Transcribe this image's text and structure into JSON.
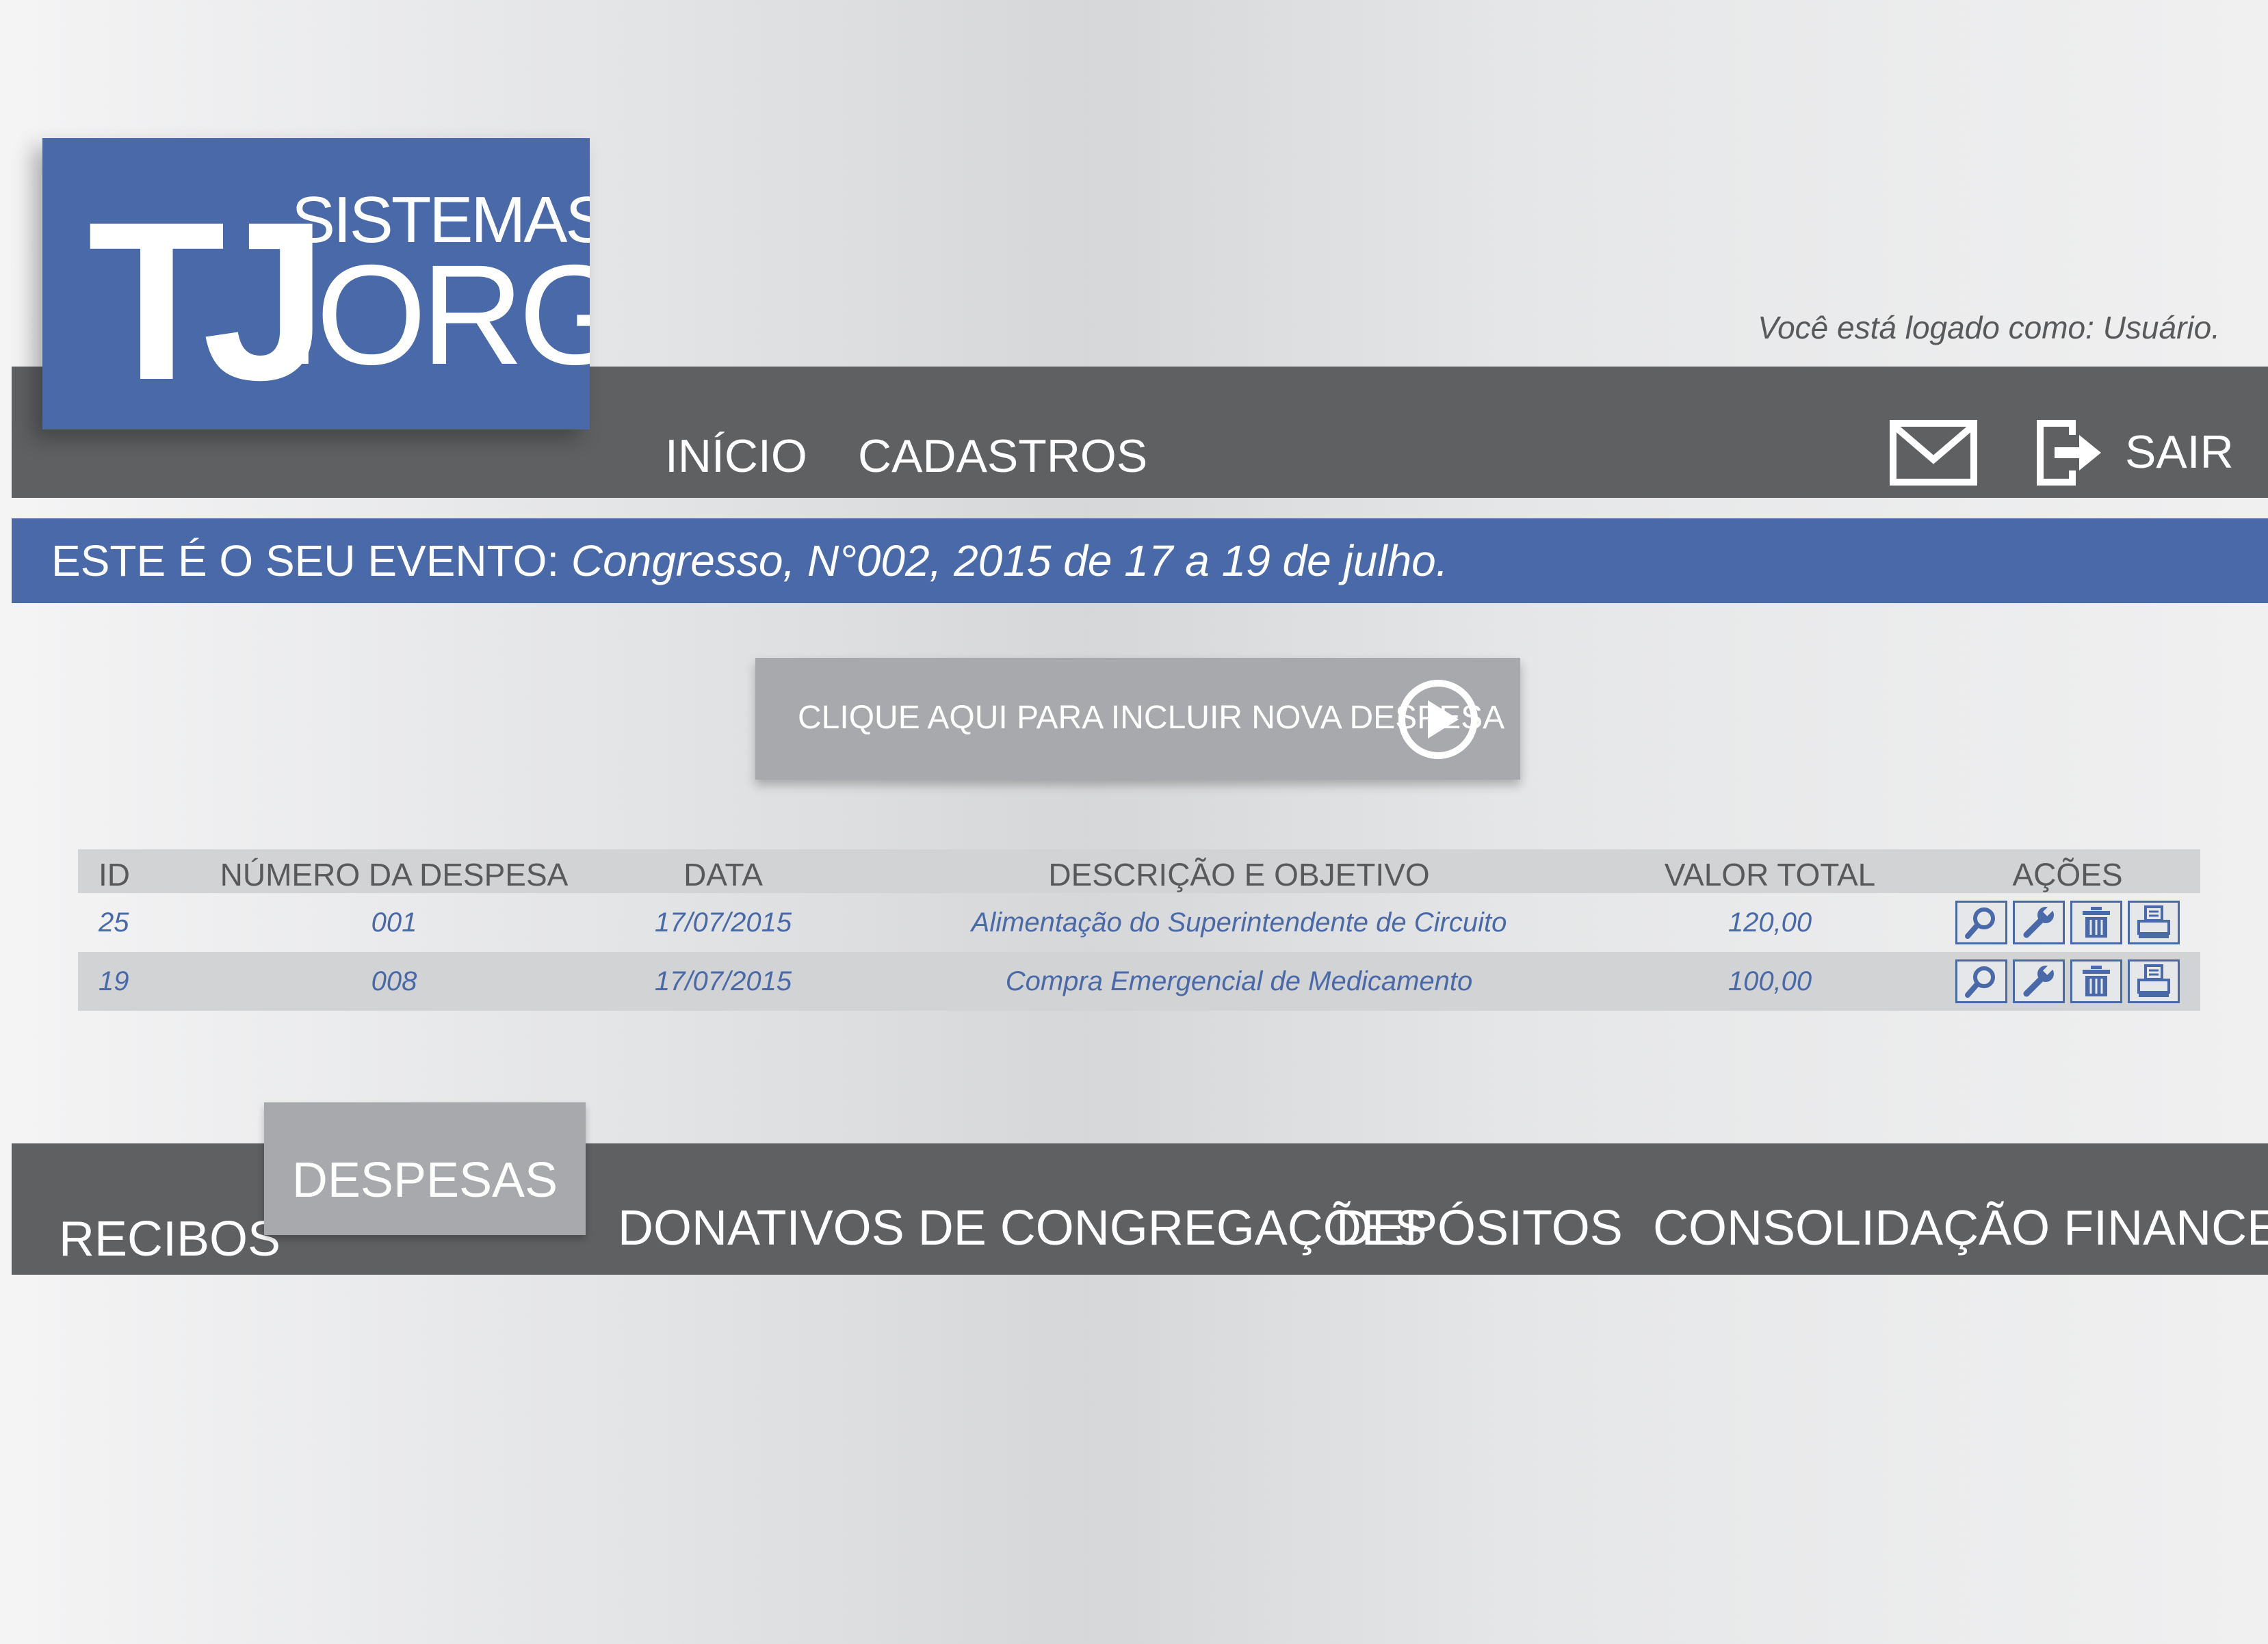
{
  "brand": {
    "logo_main": "TJ",
    "logo_top": "SISTEMAS",
    "logo_bottom": ".ORG",
    "color_primary": "#4a69a8",
    "color_bar": "#5f6062",
    "color_button": "#a7a9ac"
  },
  "session": {
    "logged_in_text": "Você está logado como: Usuário."
  },
  "top_nav": {
    "items": [
      {
        "label": "INÍCIO"
      },
      {
        "label": "CADASTROS"
      }
    ],
    "mail_icon": "mail-icon",
    "logout_icon": "logout-icon",
    "logout_label": "SAIR"
  },
  "event": {
    "prefix": "ESTE É O SEU EVENTO:",
    "value": "Congresso, N°002, 2015 de 17 a 19 de julho."
  },
  "add_button": {
    "label": "CLIQUE AQUI PARA INCLUIR NOVA DESPESA",
    "icon": "play-circle-icon"
  },
  "table": {
    "columns": [
      "ID",
      "NÚMERO DA DESPESA",
      "DATA",
      "DESCRIÇÃO E OBJETIVO",
      "VALOR TOTAL",
      "AÇÕES"
    ],
    "rows": [
      {
        "id": "25",
        "numero": "001",
        "data": "17/07/2015",
        "descricao": "Alimentação do Superintendente de Circuito",
        "valor": "120,00"
      },
      {
        "id": "19",
        "numero": "008",
        "data": "17/07/2015",
        "descricao": "Compra Emergencial de Medicamento",
        "valor": "100,00"
      }
    ],
    "action_icons": [
      "search-icon",
      "wrench-icon",
      "trash-icon",
      "printer-icon"
    ]
  },
  "bottom_tabs": {
    "items": [
      {
        "label": "RECIBOS"
      },
      {
        "label": "DESPESAS"
      },
      {
        "label": "DONATIVOS DE CONGREGAÇÕES"
      },
      {
        "label": "DEPÓSITOS"
      },
      {
        "label": "CONSOLIDAÇÃO FINANCEIRA"
      }
    ],
    "active": "DESPESAS"
  }
}
